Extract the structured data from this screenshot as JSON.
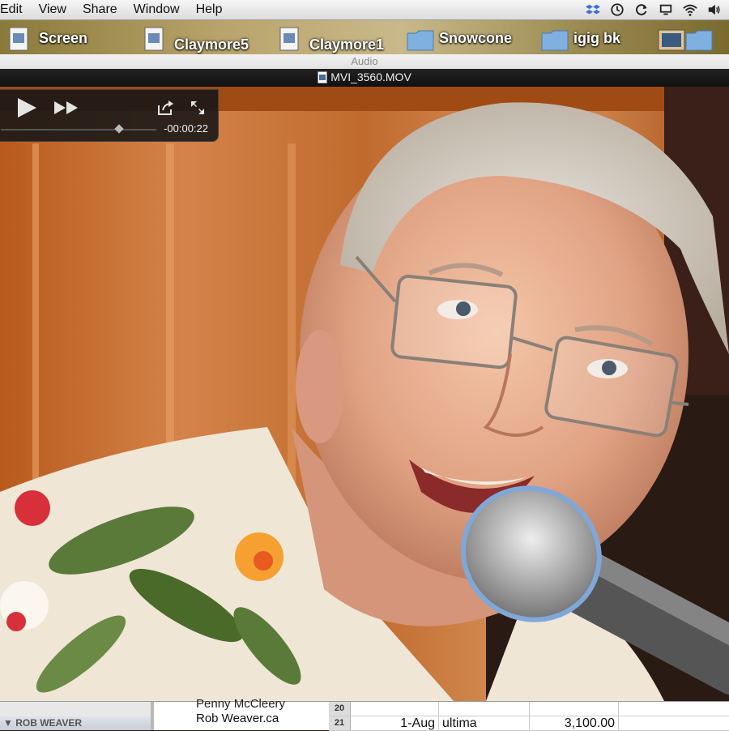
{
  "menubar": {
    "items": [
      "Edit",
      "View",
      "Share",
      "Window",
      "Help"
    ]
  },
  "status_icons": [
    "dropbox-icon",
    "time-machine-icon",
    "sync-icon",
    "display-icon",
    "wifi-icon",
    "volume-icon"
  ],
  "desktop": {
    "icons": [
      {
        "label": "Screen",
        "kind": "document"
      },
      {
        "label": "Claymore5",
        "kind": "document"
      },
      {
        "label": "Claymore1",
        "kind": "document"
      },
      {
        "label": "Snowcone",
        "kind": "folder"
      },
      {
        "label": "igig bk",
        "kind": "folder"
      }
    ]
  },
  "window": {
    "audio_label": "Audio",
    "title": "MVI_3560.MOV"
  },
  "player": {
    "time": "-00:00:22",
    "progress_fraction": 0.76
  },
  "sidebar": {
    "section_label": "ROB WEAVER"
  },
  "contacts": {
    "partial_name": "Penny McCleery",
    "name": "Rob Weaver.ca"
  },
  "spreadsheet": {
    "rows": [
      {
        "num": "20",
        "cells": [
          "",
          "",
          ""
        ]
      },
      {
        "num": "21",
        "cells": [
          "1-Aug",
          "ultima",
          "3,100.00"
        ]
      }
    ]
  },
  "colors": {
    "menubar": "#e8e8e8",
    "titlebar_dark": "#111111",
    "hud": "#161616"
  }
}
